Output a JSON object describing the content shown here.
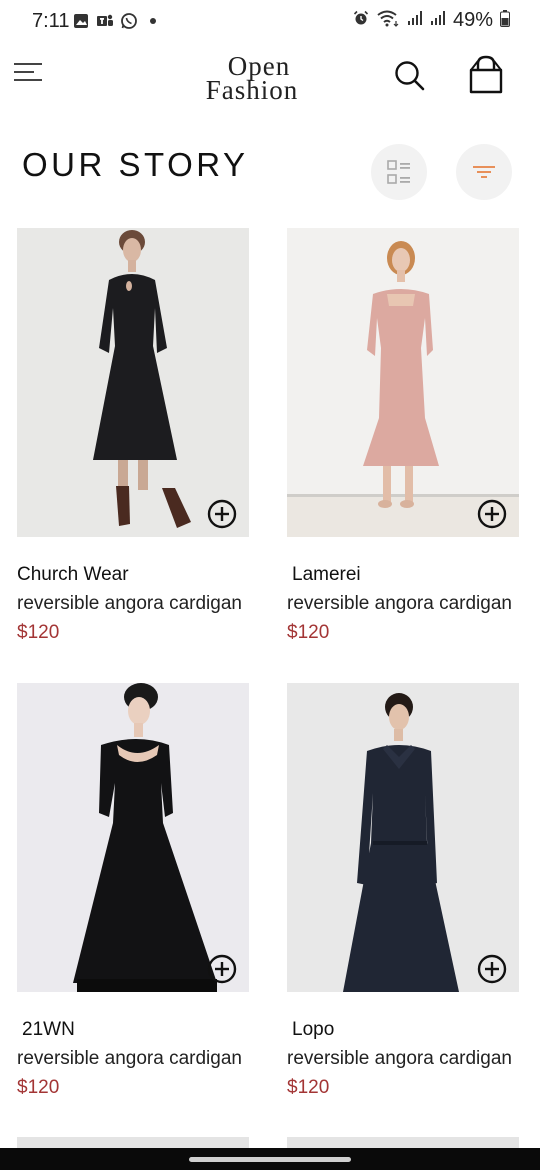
{
  "status_bar": {
    "time": "7:11",
    "battery": "49%"
  },
  "header": {
    "logo_line1": "Open",
    "logo_line2": "Fashion"
  },
  "section": {
    "title": "OUR STORY"
  },
  "products": [
    {
      "name": "Church Wear",
      "description": "reversible angora cardigan",
      "price": "$120"
    },
    {
      "name": "Lamerei",
      "description": "reversible angora cardigan",
      "price": "$120"
    },
    {
      "name": "21WN",
      "description": "reversible angora cardigan",
      "price": "$120"
    },
    {
      "name": "Lopo",
      "description": "reversible angora cardigan",
      "price": "$120"
    }
  ],
  "colors": {
    "price": "#a33535",
    "filter_accent": "#e8905a",
    "button_bg": "#f2f2f2"
  },
  "icons": {
    "menu": "menu-icon",
    "search": "search-icon",
    "bag": "shopping-bag-icon",
    "view": "list-view-icon",
    "filter": "filter-icon",
    "add": "add-circle-icon"
  }
}
